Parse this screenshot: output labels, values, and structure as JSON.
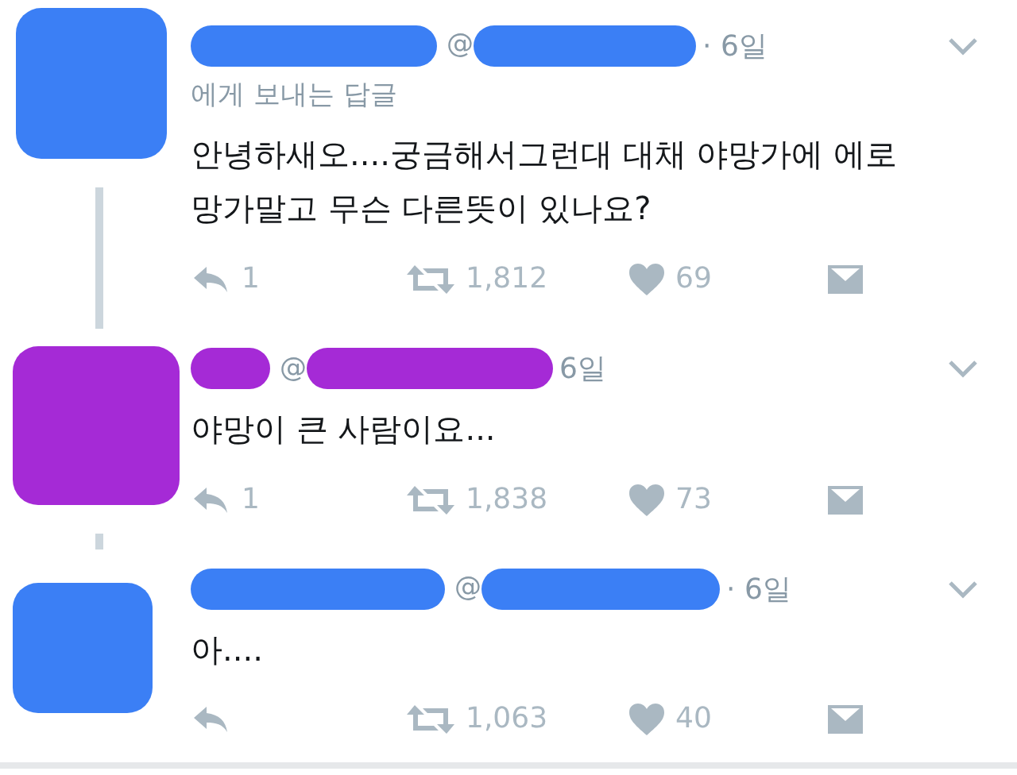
{
  "tweets": [
    {
      "color": "#3b7ff5",
      "at": "@",
      "time": "· 6일",
      "reply_to": "에게 보내는 답글",
      "text": "안녕하새오....궁금해서그런대 대채 야망가에 에로 망가말고 무슨 다른뜻이 있나요?",
      "replies": "1",
      "retweets": "1,812",
      "likes": "69"
    },
    {
      "color": "#a52ad6",
      "at": "@",
      "time": "6일",
      "text": "야망이 큰 사람이요...",
      "replies": "1",
      "retweets": "1,838",
      "likes": "73"
    },
    {
      "color": "#3b7ff5",
      "at": "@",
      "time": "· 6일",
      "text": "아....",
      "retweets": "1,063",
      "likes": "40"
    }
  ]
}
